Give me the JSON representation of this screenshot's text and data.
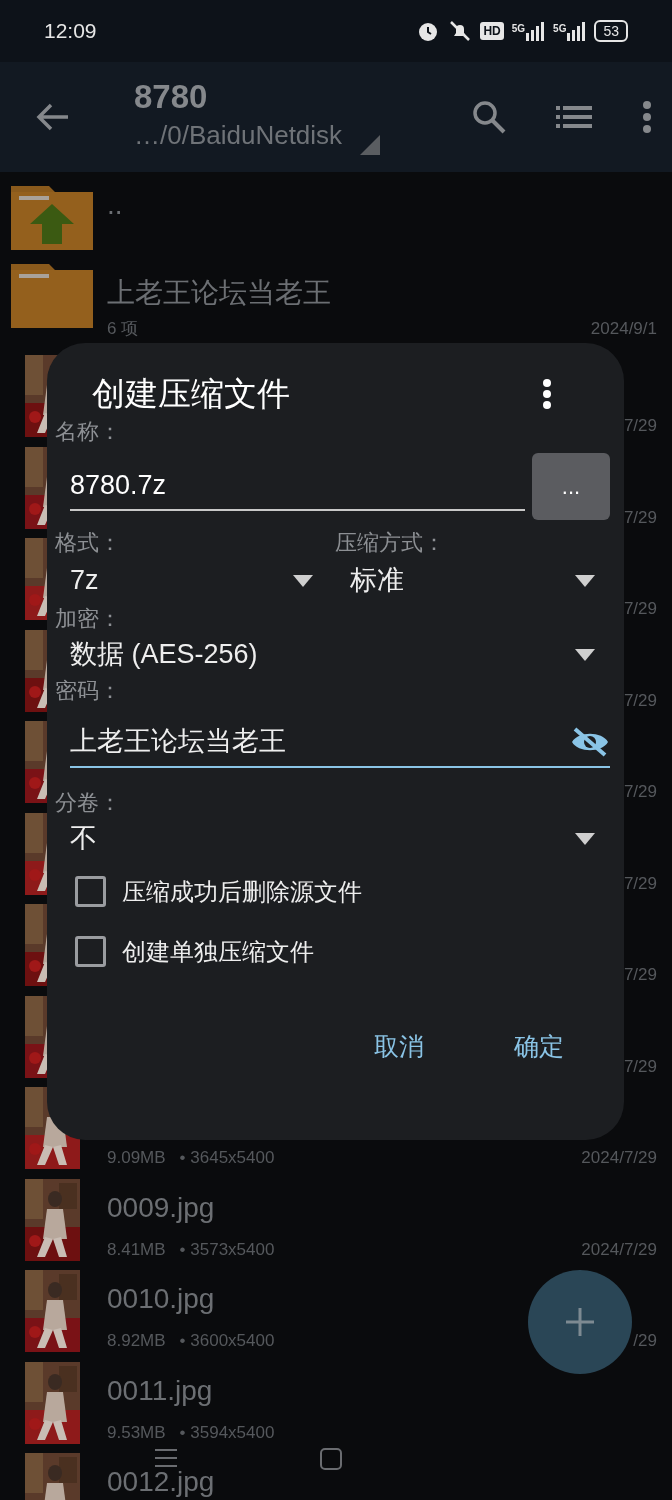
{
  "status_bar": {
    "time": "12:09",
    "hd": "HD",
    "signals": [
      {
        "label": "5G"
      },
      {
        "label": "5G"
      }
    ],
    "battery": "53"
  },
  "app_bar": {
    "title": "8780",
    "path": "…/0/BaiduNetdisk"
  },
  "files": [
    {
      "kind": "parent",
      "name": ".."
    },
    {
      "kind": "folder",
      "name": "上老王论坛当老王",
      "count": "6 项",
      "date": "2024/9/1"
    },
    {
      "date": "7/29"
    },
    {
      "date": "7/29"
    },
    {
      "date": "7/29"
    },
    {
      "date": "7/29"
    },
    {
      "date": "7/29"
    },
    {
      "date": "7/29"
    },
    {
      "date": "7/29"
    },
    {
      "date": "7/29"
    },
    {
      "size": "9.09MB",
      "dimensions": "• 3645x5400",
      "date": "2024/7/29"
    },
    {
      "name": "0009.jpg",
      "size": "8.41MB",
      "dimensions": "• 3573x5400",
      "date": "2024/7/29"
    },
    {
      "name": "0010.jpg",
      "size": "8.92MB",
      "dimensions": "• 3600x5400",
      "date": "/29"
    },
    {
      "name": "0011.jpg",
      "size": "9.53MB",
      "dimensions": "• 3594x5400"
    },
    {
      "name": "0012.jpg"
    }
  ],
  "dialog": {
    "title": "创建压缩文件",
    "name_label": "名称：",
    "name_value": "8780.7z",
    "browse_button": "...",
    "format_label": "格式：",
    "format_value": "7z",
    "method_label": "压缩方式：",
    "method_value": "标准",
    "encryption_label": "加密：",
    "encryption_value": "数据 (AES-256)",
    "password_label": "密码：",
    "password_value": "上老王论坛当老王",
    "split_label": "分卷：",
    "split_value": "不",
    "options": [
      {
        "label": "压缩成功后删除源文件",
        "checked": false
      },
      {
        "label": "创建单独压缩文件",
        "checked": false
      }
    ],
    "buttons": [
      {
        "label": "取消"
      },
      {
        "label": "确定"
      }
    ]
  }
}
